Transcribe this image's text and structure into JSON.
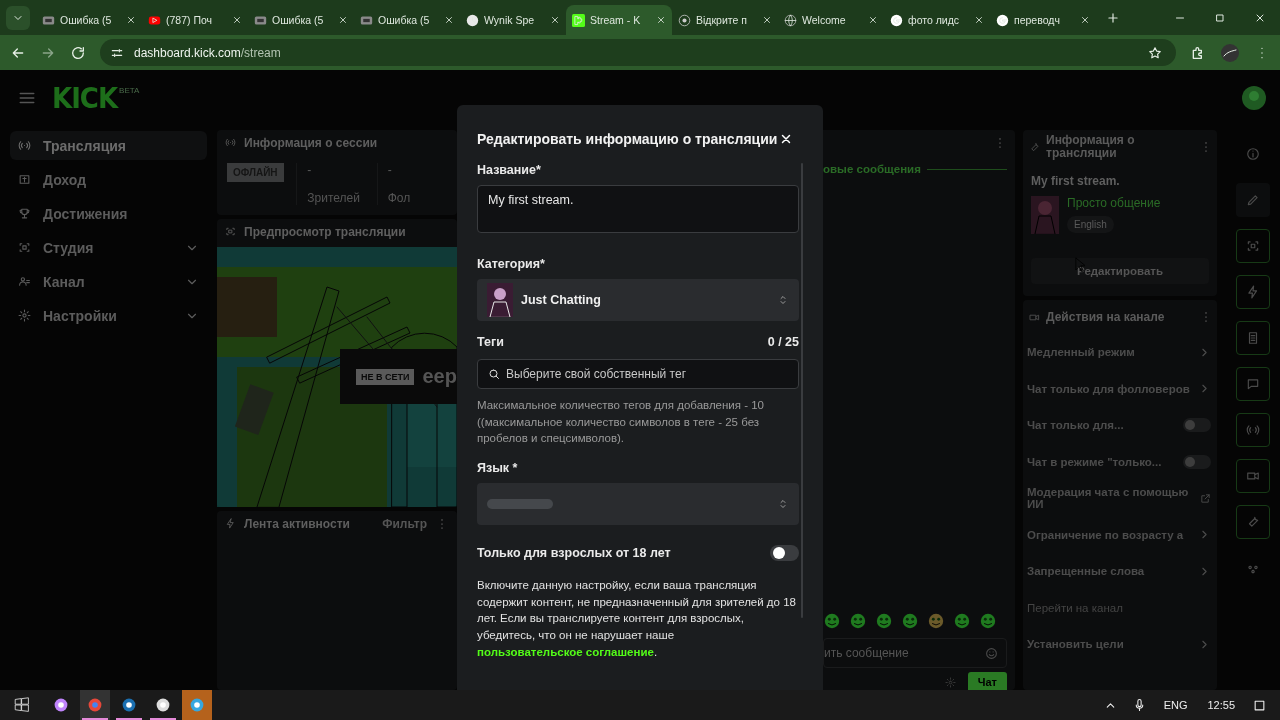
{
  "browser": {
    "tabs": [
      {
        "title": "Ошибка (5",
        "selected": false
      },
      {
        "title": "(787) Поч",
        "selected": false
      },
      {
        "title": "Ошибка (5",
        "selected": false
      },
      {
        "title": "Ошибка (5",
        "selected": false
      },
      {
        "title": "Wynik Spe",
        "selected": false
      },
      {
        "title": "Stream - K",
        "selected": true
      },
      {
        "title": "Відкрите п",
        "selected": false
      },
      {
        "title": "Welcome",
        "selected": false
      },
      {
        "title": "фото лидс",
        "selected": false
      },
      {
        "title": "переводч",
        "selected": false
      }
    ],
    "url_host": "dashboard.kick.com",
    "url_path": "/stream"
  },
  "header": {
    "logo": "KICK",
    "logo_badge": "BETA"
  },
  "sidebar": {
    "items": [
      {
        "label": "Трансляция",
        "selected": true,
        "expandable": false
      },
      {
        "label": "Доход",
        "selected": false,
        "expandable": false
      },
      {
        "label": "Достижения",
        "selected": false,
        "expandable": false
      },
      {
        "label": "Студия",
        "selected": false,
        "expandable": true
      },
      {
        "label": "Канал",
        "selected": false,
        "expandable": true
      },
      {
        "label": "Настройки",
        "selected": false,
        "expandable": true
      }
    ]
  },
  "session": {
    "title": "Информация о сессии",
    "status": "ОФЛАЙН",
    "stats": [
      {
        "value": "-",
        "label": "Зрителей"
      },
      {
        "value": "-",
        "label": "Фол"
      }
    ]
  },
  "preview": {
    "title": "Предпросмотр трансляции",
    "badge": "НЕ В СЕТИ",
    "overlay_text": "eep"
  },
  "activity": {
    "title": "Лента активности",
    "filter": "Фильтр"
  },
  "chat": {
    "divider": "овые сообщения",
    "input_placeholder": "ить сообщение",
    "send": "Чат"
  },
  "modal": {
    "title": "Редактировать информацию о трансляции",
    "name_label": "Название*",
    "name_value": "My first stream.",
    "category_label": "Категория*",
    "category_value": "Just Chatting",
    "tags_label": "Теги",
    "tags_count": "0 / 25",
    "tags_placeholder": "Выберите свой собственный тег",
    "tags_hint": "Максимальное количество тегов для добавления - 10 ((максимальное количество символов в теге - 25 без пробелов и спецсимволов).",
    "language_label": "Язык *",
    "adult_label": "Только для взрослых от 18 лет",
    "adult_on": false,
    "adult_text": "Включите данную настройку, если ваша трансляция содержит контент, не предназначенный для зрителей до 18 лет. Если вы транслируете контент для взрослых, убедитесь, что он не нарушает наше",
    "adult_link": "пользовательское соглашение",
    "adult_end": "."
  },
  "stream_info": {
    "title": "Информация о трансляции",
    "stream_title": "My first stream.",
    "category": "Просто общение",
    "language": "English",
    "edit_button": "Редактировать"
  },
  "channel_actions": {
    "title": "Действия на канале",
    "items": [
      {
        "label": "Медленный режим",
        "kind": "chevron"
      },
      {
        "label": "Чат только для фолловеров",
        "kind": "chevron"
      },
      {
        "label": "Чат только для...",
        "kind": "toggle",
        "on": false
      },
      {
        "label": "Чат в режиме \"только...",
        "kind": "toggle",
        "on": false
      },
      {
        "label": "Модерация чата с помощью ИИ",
        "kind": "external"
      },
      {
        "label": "Ограничение по возрасту а",
        "kind": "chevron"
      },
      {
        "label": "Запрещенные слова",
        "kind": "chevron"
      },
      {
        "label": "Перейти на канал",
        "kind": "disabled"
      },
      {
        "label": "Установить цели",
        "kind": "chevron"
      }
    ]
  },
  "taskbar": {
    "apps": [
      {
        "running": false,
        "attention": false
      },
      {
        "running": true,
        "attention": false
      },
      {
        "running": true,
        "attention": false
      },
      {
        "running": true,
        "attention": false
      },
      {
        "running": false,
        "attention": true
      }
    ],
    "lang": "ENG",
    "time": "12:55"
  }
}
